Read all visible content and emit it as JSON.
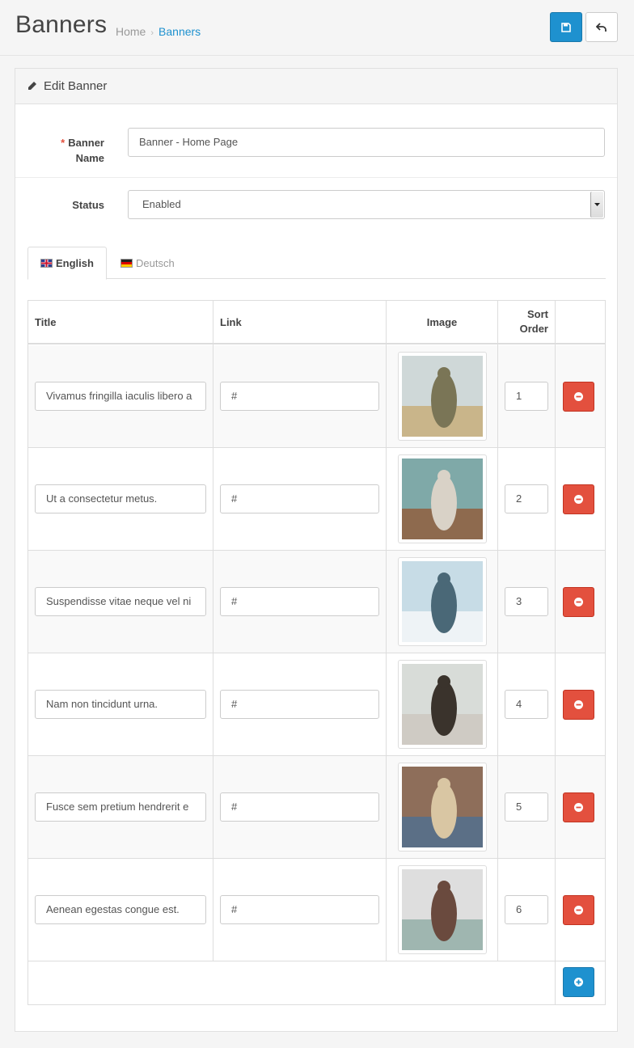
{
  "header": {
    "title": "Banners",
    "breadcrumb": [
      "Home",
      "Banners"
    ],
    "save_icon": "save-icon",
    "back_icon": "reply-icon"
  },
  "panel": {
    "title": "Edit Banner",
    "icon": "pencil-icon"
  },
  "form": {
    "name_label_line1": "Banner",
    "name_label_line2": "Name",
    "name_value": "Banner - Home Page",
    "status_label": "Status",
    "status_value": "Enabled"
  },
  "tabs": [
    {
      "label": "English",
      "flag": "uk-flag-icon",
      "active": true
    },
    {
      "label": "Deutsch",
      "flag": "de-flag-icon",
      "active": false
    }
  ],
  "table": {
    "headers": {
      "title": "Title",
      "link": "Link",
      "image": "Image",
      "sort_line1": "Sort",
      "sort_line2": "Order"
    },
    "rows": [
      {
        "title": "Vivamus fringilla iaculis libero a",
        "link": "#",
        "sort": "1",
        "image": "woman-in-field-photo"
      },
      {
        "title": "Ut a consectetur metus.",
        "link": "#",
        "sort": "2",
        "image": "woman-with-sunglasses-photo"
      },
      {
        "title": "Suspendisse vitae neque vel ni",
        "link": "#",
        "sort": "3",
        "image": "snowy-mountain-photo"
      },
      {
        "title": "Nam non tincidunt urna.",
        "link": "#",
        "sort": "4",
        "image": "woman-by-rock-photo"
      },
      {
        "title": "Fusce sem pretium hendrerit e",
        "link": "#",
        "sort": "5",
        "image": "blonde-woman-photo"
      },
      {
        "title": "Aenean egestas congue est.",
        "link": "#",
        "sort": "6",
        "image": "woman-in-dress-photo"
      }
    ]
  },
  "colors": {
    "primary": "#1e91cf",
    "danger": "#e3503e",
    "required": "#e3503e"
  }
}
